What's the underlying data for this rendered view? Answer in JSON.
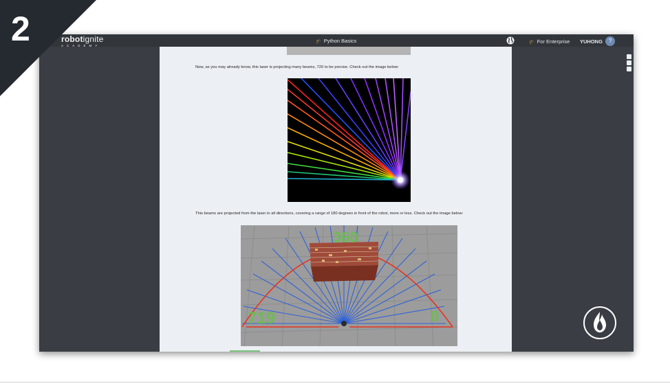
{
  "badge": {
    "number": "2"
  },
  "navbar": {
    "brand_bold": "robot",
    "brand_light": "ignite",
    "brand_sub": "ACADEMY",
    "course_title": "Python Basics",
    "enterprise_label": "For Enterprise",
    "username": "YUHONG",
    "help_label": "?"
  },
  "content": {
    "paragraph1": "Now, as you may already know, this laser is projecting many beams, 720 to be precise. Check out the image below:",
    "paragraph2": "This beams are projected from the laser in all directions, covering a range of 180 degrees in front of the robot, more or less. Check out the image below:",
    "robot_image": {
      "label_left": "719",
      "label_center": "360",
      "label_right": "0"
    }
  },
  "colors": {
    "window_bg": "#3a3e44",
    "navbar_bg": "#32363b",
    "content_bg": "#eceff3",
    "label_green": "#6abf4b",
    "arc_red": "#e8321e",
    "ray_blue": "#3a6fe0"
  }
}
